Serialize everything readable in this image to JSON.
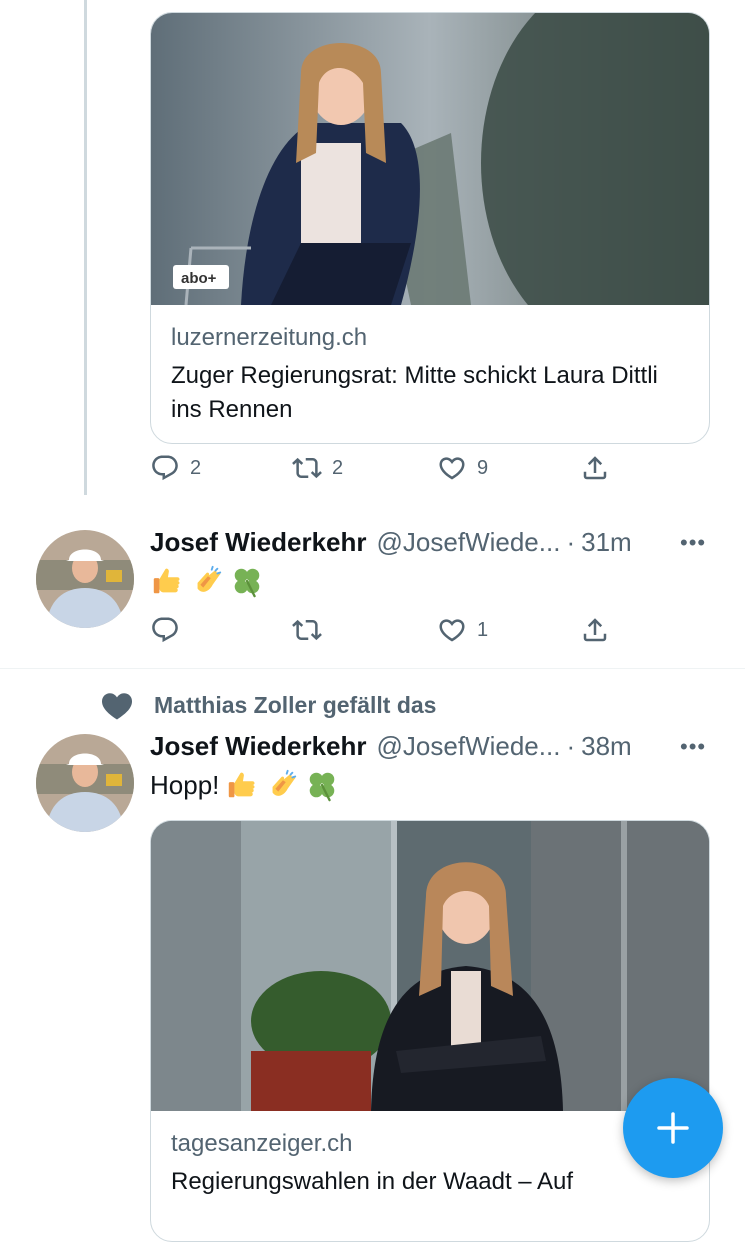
{
  "tweet1": {
    "card": {
      "badge": "abo+",
      "domain": "luzernerzeitung.ch",
      "headline": "Zuger Regierungsrat: Mitte schickt Laura Dittli ins Rennen"
    },
    "counts": {
      "replies": "2",
      "retweets": "2",
      "likes": "9"
    }
  },
  "tweet2": {
    "name": "Josef Wiederkehr",
    "handle": "@JosefWiede...",
    "dot": "·",
    "time": "31m",
    "more": "•••",
    "emojis": [
      "thumbs-up",
      "clapping-hands",
      "four-leaf-clover"
    ],
    "counts": {
      "replies": "",
      "retweets": "",
      "likes": "1"
    }
  },
  "tweet3": {
    "social_context": "Matthias Zoller gefällt das",
    "name": "Josef Wiederkehr",
    "handle": "@JosefWiede...",
    "dot": "·",
    "time": "38m",
    "more": "•••",
    "text": "Hopp!",
    "emojis": [
      "thumbs-up",
      "clapping-hands",
      "four-leaf-clover"
    ],
    "card": {
      "domain": "tagesanzeiger.ch",
      "headline": "Regierungswahlen in der Waadt – Auf"
    }
  },
  "fab": {
    "icon": "plus-icon"
  },
  "colors": {
    "accent": "#1d9bf0",
    "secondary_text": "#536471",
    "border": "#cfd9de"
  }
}
